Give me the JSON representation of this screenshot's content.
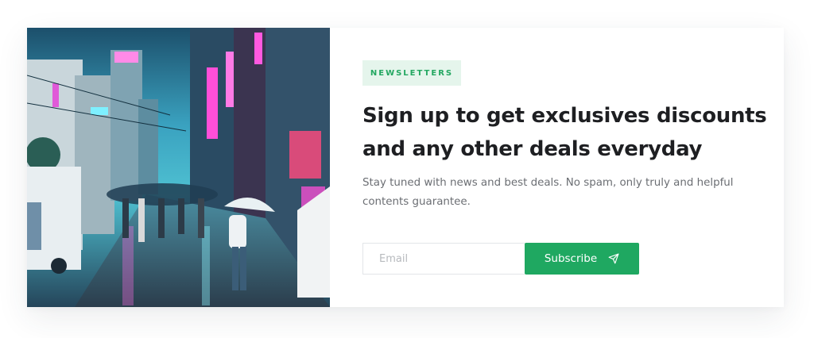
{
  "photo": {
    "alt_subject": "rainy-neon-street-photo"
  },
  "newsletter": {
    "tag": "NEWSLETTERS",
    "title": "Sign up to get exclusives discounts and any other deals everyday",
    "description": "Stay tuned with news and best deals. No spam, only truly and helpful contents guarantee.",
    "email_placeholder": "Email",
    "subscribe_label": "Subscribe",
    "subscribe_icon": "send-icon"
  },
  "colors": {
    "accent": "#1fa861",
    "tag_bg": "#e5f5ec",
    "title": "#1e1f22",
    "text": "#6b6e73"
  }
}
